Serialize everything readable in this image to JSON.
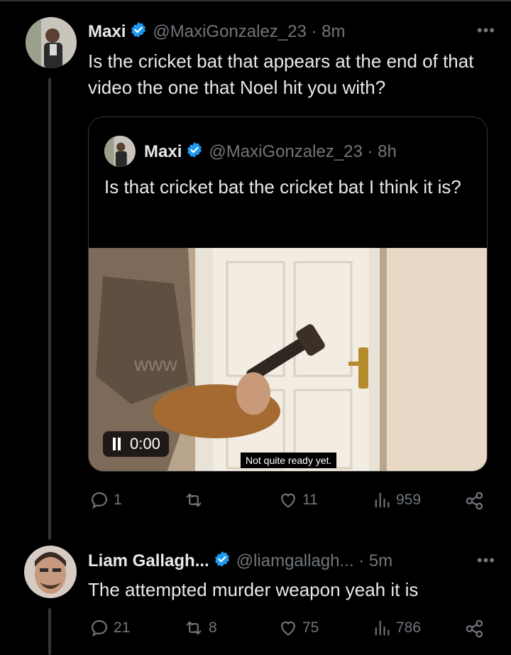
{
  "tweet1": {
    "name": "Maxi",
    "handle_time": "@MaxiGonzalez_23 · 8m",
    "text": "Is the cricket bat that appears at the end of that video the one that Noel hit you with?",
    "quote": {
      "name": "Maxi",
      "handle_time": "@MaxiGonzalez_23 · 8h",
      "text": "Is that cricket bat the cricket bat I think it is?",
      "video": {
        "time": "0:00",
        "subtitle": "Not quite ready yet.",
        "watermark": "www"
      }
    },
    "actions": {
      "replies": "1",
      "reposts": "",
      "likes": "11",
      "views": "959"
    }
  },
  "tweet2": {
    "name": "Liam Gallagh...",
    "handle_time": "@liamgallagh... · 5m",
    "text": "The attempted murder weapon yeah it is",
    "actions": {
      "replies": "21",
      "reposts": "8",
      "likes": "75",
      "views": "786"
    }
  },
  "colors": {
    "verified": "#1d9bf0",
    "muted": "#71767b",
    "text": "#e7e9ea",
    "border": "#333639"
  }
}
